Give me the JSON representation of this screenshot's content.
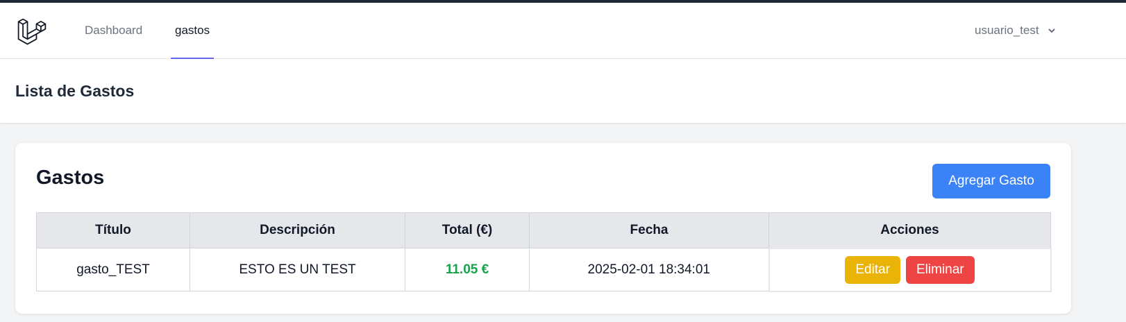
{
  "nav": {
    "logo_icon": "laravel-logo-icon",
    "links": [
      {
        "label": "Dashboard",
        "active": false
      },
      {
        "label": "gastos",
        "active": true
      }
    ],
    "user": {
      "name": "usuario_test",
      "icon": "chevron-down-icon"
    }
  },
  "header": {
    "title": "Lista de Gastos"
  },
  "card": {
    "title": "Gastos",
    "add_button_label": "Agregar Gasto",
    "table": {
      "columns": [
        "Título",
        "Descripción",
        "Total (€)",
        "Fecha",
        "Acciones"
      ],
      "rows": [
        {
          "titulo": "gasto_TEST",
          "descripcion": "ESTO ES UN TEST",
          "total": "11.05 €",
          "fecha": "2025-02-01 18:34:01",
          "edit_label": "Editar",
          "delete_label": "Eliminar"
        }
      ]
    }
  },
  "colors": {
    "accent": "#6366f1",
    "primary_button": "#3b82f6",
    "edit_button": "#eab308",
    "delete_button": "#ef4444",
    "total_text": "#16a34a"
  }
}
